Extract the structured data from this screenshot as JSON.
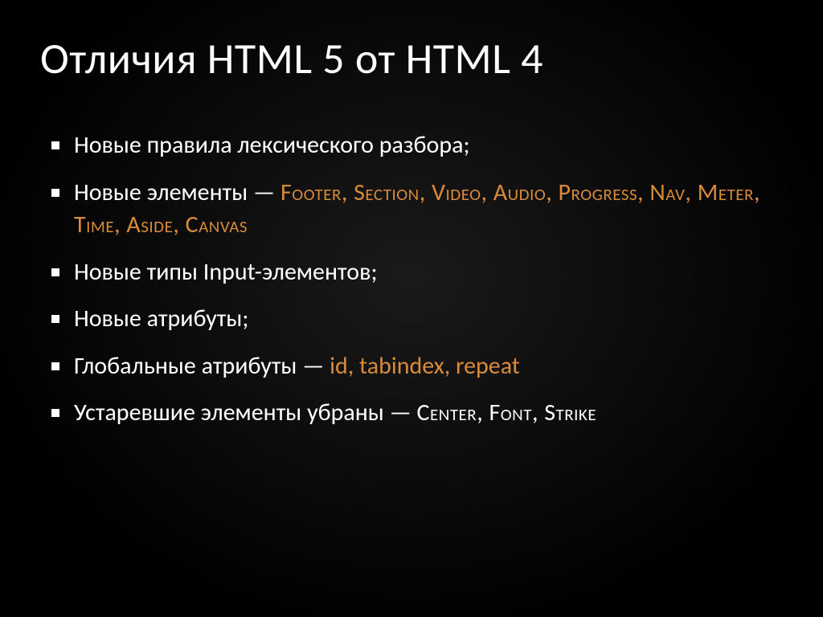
{
  "slide": {
    "title": "Отличия HTML 5 от HTML 4",
    "bullets": [
      {
        "prefix": "Новые правила лексического разбора;",
        "highlight": "",
        "suffix": ""
      },
      {
        "prefix": "Новые элементы — ",
        "highlight": "Footer, Section, Video, Audio, Progress, Nav, Meter, Time, Aside, Canvas",
        "suffix": ""
      },
      {
        "prefix": "Новые типы Input-элементов;",
        "highlight": "",
        "suffix": ""
      },
      {
        "prefix": "Новые атрибуты;",
        "highlight": "",
        "suffix": ""
      },
      {
        "prefix": "Глобальные атрибуты — ",
        "highlight": "id, tabindex, repeat",
        "suffix": ""
      },
      {
        "prefix": "Устаревшие элементы убраны — ",
        "highlight": "",
        "suffix": "Center, Font, Strike"
      }
    ]
  }
}
